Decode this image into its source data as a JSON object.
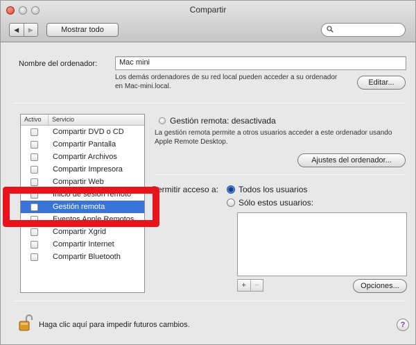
{
  "window": {
    "title": "Compartir"
  },
  "toolbar": {
    "back_glyph": "◀",
    "forward_glyph": "▶",
    "show_all_label": "Mostrar todo",
    "search_placeholder": ""
  },
  "computer_name": {
    "label": "Nombre del ordenador:",
    "value": "Mac mini",
    "description": "Los demás ordenadores de su red local pueden acceder a su ordenador en Mac-mini.local.",
    "edit_button": "Editar..."
  },
  "services": {
    "col_active": "Activo",
    "col_service": "Servicio",
    "items": [
      {
        "label": "Compartir DVD o CD",
        "checked": false,
        "selected": false
      },
      {
        "label": "Compartir Pantalla",
        "checked": false,
        "selected": false
      },
      {
        "label": "Compartir Archivos",
        "checked": false,
        "selected": false
      },
      {
        "label": "Compartir Impresora",
        "checked": false,
        "selected": false
      },
      {
        "label": "Compartir Web",
        "checked": false,
        "selected": false
      },
      {
        "label": "Inicio de sesión remoto",
        "checked": false,
        "selected": false
      },
      {
        "label": "Gestión remota",
        "checked": false,
        "selected": true
      },
      {
        "label": "Eventos Apple Remotos",
        "checked": false,
        "selected": false
      },
      {
        "label": "Compartir Xgrid",
        "checked": false,
        "selected": false
      },
      {
        "label": "Compartir Internet",
        "checked": false,
        "selected": false
      },
      {
        "label": "Compartir Bluetooth",
        "checked": false,
        "selected": false
      }
    ]
  },
  "detail": {
    "status": "Gestión remota: desactivada",
    "description": "La gestión remota permite a otros usuarios acceder a este ordenador usando Apple Remote Desktop.",
    "settings_button": "Ajustes del ordenador...",
    "access_label": "Permitir acceso a:",
    "option_all": "Todos los usuarios",
    "option_only": "Sólo estos usuarios:",
    "add_glyph": "+",
    "remove_glyph": "−",
    "options_button": "Opciones..."
  },
  "footer": {
    "lock_text": "Haga clic aquí para impedir futuros cambios.",
    "help_glyph": "?"
  },
  "colors": {
    "selection": "#3875d7",
    "highlight": "#e8141d"
  }
}
